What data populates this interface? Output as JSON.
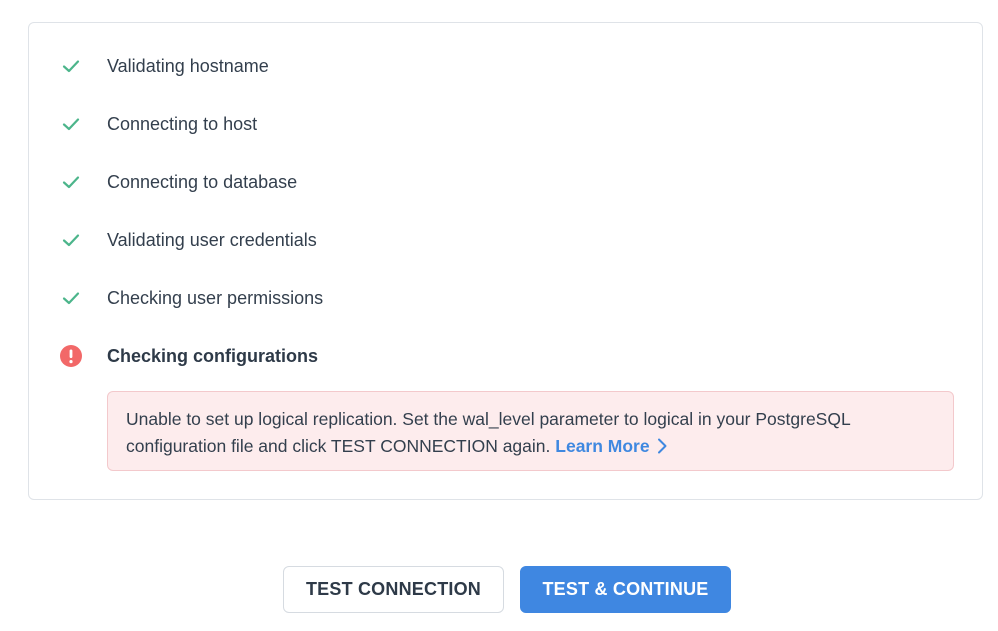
{
  "steps": [
    {
      "label": "Validating hostname",
      "status": "success",
      "icon": "check-icon"
    },
    {
      "label": "Connecting to host",
      "status": "success",
      "icon": "check-icon"
    },
    {
      "label": "Connecting to database",
      "status": "success",
      "icon": "check-icon"
    },
    {
      "label": "Validating user credentials",
      "status": "success",
      "icon": "check-icon"
    },
    {
      "label": "Checking user permissions",
      "status": "success",
      "icon": "check-icon"
    },
    {
      "label": "Checking configurations",
      "status": "error",
      "icon": "error-icon"
    }
  ],
  "error_alert": {
    "message": "Unable to set up logical replication. Set the wal_level parameter to logical in your PostgreSQL configuration file and click TEST CONNECTION again.",
    "link_label": "Learn More",
    "link_icon": "chevron-right-icon"
  },
  "buttons": {
    "test_connection": "TEST CONNECTION",
    "test_and_continue": "TEST & CONTINUE"
  },
  "colors": {
    "success": "#4cb58b",
    "error": "#f26868",
    "primary": "#3f87e1",
    "alert_background": "#fdeced",
    "alert_border": "#f3c9cc",
    "link": "#3f88e0"
  }
}
